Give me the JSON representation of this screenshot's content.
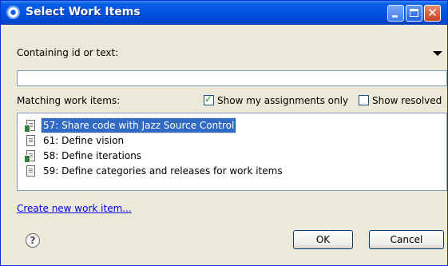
{
  "window": {
    "title": "Select Work Items"
  },
  "filter": {
    "label": "Containing id or text:",
    "value": ""
  },
  "options": {
    "matching_label": "Matching work items:",
    "show_my_assignments": {
      "label": "Show my assignments only",
      "checked": true
    },
    "show_resolved": {
      "label": "Show resolved",
      "checked": false
    }
  },
  "work_items": [
    {
      "text": "57: Share code with Jazz Source Control",
      "selected": true
    },
    {
      "text": "61: Define vision",
      "selected": false
    },
    {
      "text": "58: Define iterations",
      "selected": false
    },
    {
      "text": "59: Define categories and releases for work items",
      "selected": false
    }
  ],
  "footer": {
    "create_link": "Create new work item...",
    "help_icon": "?",
    "ok": "OK",
    "cancel": "Cancel"
  }
}
